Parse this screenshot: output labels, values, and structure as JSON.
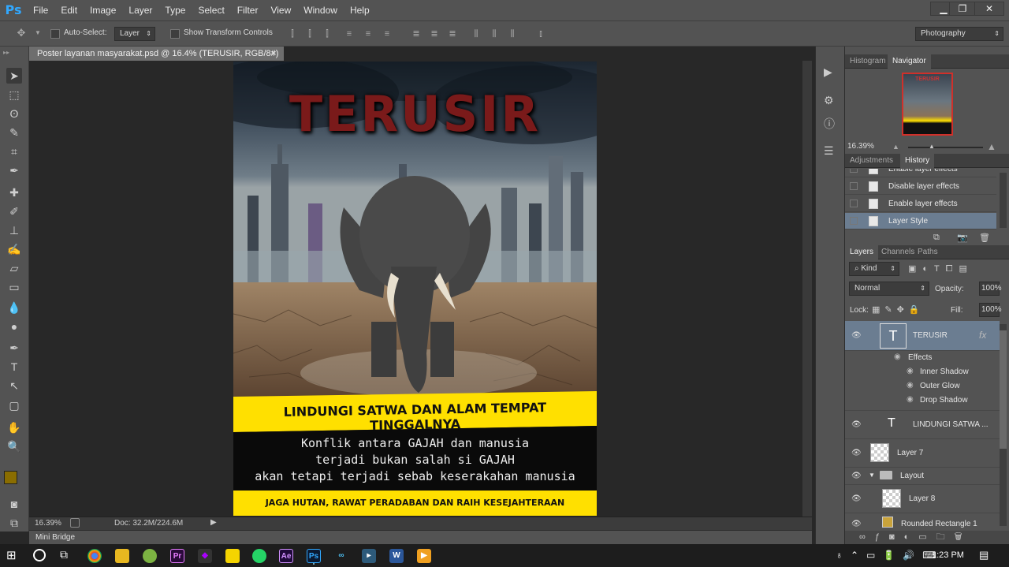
{
  "app": {
    "logo": "Ps"
  },
  "menu": [
    "File",
    "Edit",
    "Image",
    "Layer",
    "Type",
    "Select",
    "Filter",
    "View",
    "Window",
    "Help"
  ],
  "window_controls": {
    "minimize": "▁",
    "restore": "❐",
    "close": "✕"
  },
  "options": {
    "auto_select_label": "Auto-Select:",
    "auto_select_value": "Layer",
    "show_transform_label": "Show Transform Controls",
    "workspace": "Photography"
  },
  "document": {
    "tab_title": "Poster layanan masyarakat.psd @ 16.4% (TERUSIR, RGB/8#)",
    "close": "×"
  },
  "poster": {
    "title": "TERUSIR",
    "banner": "LINDUNGI SATWA DAN ALAM TEMPAT TINGGALNYA",
    "body_lines": [
      "Konflik antara GAJAH dan manusia",
      "terjadi bukan salah si GAJAH",
      "akan tetapi terjadi sebab keserakahan manusia"
    ],
    "footer": "JAGA HUTAN, RAWAT PERADABAN DAN RAIH KESEJAHTERAAN"
  },
  "status": {
    "zoom": "16.39%",
    "doc": "Doc: 32.2M/224.6M"
  },
  "mini_bridge": "Mini Bridge",
  "navigator": {
    "tabs": [
      "Histogram",
      "Navigator"
    ],
    "active": "Navigator",
    "zoom": "16.39%",
    "thumb_title": "TERUSIR"
  },
  "history": {
    "tabs": [
      "Adjustments",
      "History"
    ],
    "active": "History",
    "items": [
      "Enable layer effects",
      "Disable layer effects",
      "Enable layer effects",
      "Layer Style"
    ]
  },
  "layers": {
    "tabs": [
      "Layers",
      "Channels",
      "Paths"
    ],
    "active": "Layers",
    "filter": "Kind",
    "blend": "Normal",
    "opacity_label": "Opacity:",
    "opacity": "100%",
    "lock_label": "Lock:",
    "fill_label": "Fill:",
    "fill": "100%",
    "items": [
      {
        "name": "TERUSIR",
        "fx": "fx"
      },
      {
        "name": "Effects"
      },
      {
        "name": "Inner Shadow"
      },
      {
        "name": "Outer Glow"
      },
      {
        "name": "Drop Shadow"
      },
      {
        "name": "LINDUNGI SATWA ..."
      },
      {
        "name": "Layer 7"
      },
      {
        "name": "Layout"
      },
      {
        "name": "Layer 8"
      },
      {
        "name": "Rounded Rectangle 1"
      }
    ]
  },
  "taskbar": {
    "time": "1:23 PM"
  }
}
